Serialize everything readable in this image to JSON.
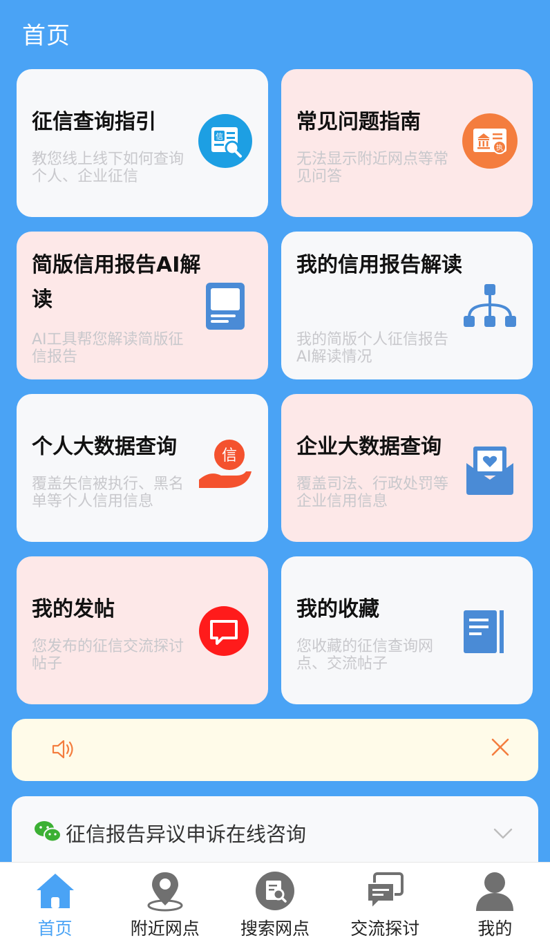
{
  "header": {
    "title": "首页"
  },
  "cards": [
    {
      "title": "征信查询指引",
      "desc": "教您线上线下如何查询个人、企业征信",
      "icon": "credit-search-icon"
    },
    {
      "title": "常见问题指南",
      "desc": "无法显示附近网点等常见问答",
      "icon": "bank-license-icon"
    },
    {
      "title": "简版信用报告AI解读",
      "desc": "AI工具帮您解读简版征信报告",
      "icon": "report-book-icon"
    },
    {
      "title": "我的信用报告解读",
      "desc": "我的简版个人征信报告AI解读情况",
      "icon": "hierarchy-icon"
    },
    {
      "title": "个人大数据查询",
      "desc": "覆盖失信被执行、黑名单等个人信用信息",
      "icon": "hand-credit-icon"
    },
    {
      "title": "企业大数据查询",
      "desc": "覆盖司法、行政处罚等企业信用信息",
      "icon": "envelope-heart-icon"
    },
    {
      "title": "我的发帖",
      "desc": "您发布的征信交流探讨帖子",
      "icon": "chat-bubble-icon"
    },
    {
      "title": "我的收藏",
      "desc": "您收藏的征信查询网点、交流帖子",
      "icon": "notebook-icon"
    }
  ],
  "notice": {
    "text": ""
  },
  "consult": {
    "label": "征信报告异议申诉在线咨询"
  },
  "tabs": [
    {
      "label": "首页",
      "icon": "home-icon"
    },
    {
      "label": "附近网点",
      "icon": "location-pin-icon"
    },
    {
      "label": "搜索网点",
      "icon": "search-doc-icon"
    },
    {
      "label": "交流探讨",
      "icon": "discussion-icon"
    },
    {
      "label": "我的",
      "icon": "user-icon"
    }
  ],
  "colors": {
    "background": "#4aa3f5",
    "card_white": "#f7f8fa",
    "card_pink": "#fde8e8",
    "notice_bg": "#fffbe9",
    "accent_orange": "#f47d3e",
    "accent_red": "#ff1b1b",
    "icon_blue": "#4a8bd6",
    "tab_active": "#4aa3f5",
    "tab_inactive": "#707070"
  }
}
